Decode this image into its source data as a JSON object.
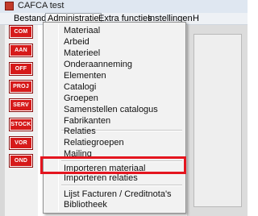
{
  "window": {
    "title": "CAFCA test"
  },
  "menubar": {
    "items": [
      "Bestand",
      "Administratie",
      "Extra functies",
      "Instellingen",
      "H"
    ]
  },
  "sidebar": {
    "buttons": [
      "COM",
      "AAN",
      "OFF",
      "PROJ",
      "SERV",
      "STOCK",
      "VOR",
      "OND"
    ]
  },
  "dropdown": {
    "group1": [
      "Materiaal",
      "Arbeid",
      "Materieel",
      "Onderaanneming",
      "Elementen",
      "Catalogi",
      "Groepen",
      "Samenstellen catalogus",
      "Fabrikanten"
    ],
    "group2": [
      "Relaties",
      "Relatiegroepen",
      "Mailing"
    ],
    "group3": [
      "Importeren materiaal",
      "Importeren relaties"
    ],
    "group4": [
      "Lijst Facturen / Creditnota's",
      "Bibliotheek"
    ]
  },
  "colors": {
    "accent": "#e4151f",
    "sidebar_button": "#d61a1a"
  }
}
